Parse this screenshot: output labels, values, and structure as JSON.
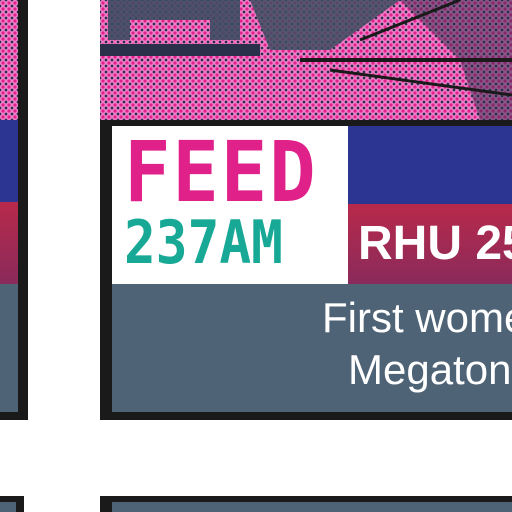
{
  "logo": {
    "line1": "FEED",
    "line2": "237AM"
  },
  "banner": {
    "code": "RHU 25"
  },
  "description": {
    "line1": "First wome",
    "line2": "Megaton"
  },
  "colors": {
    "magenta": "#e0218a",
    "teal": "#17a896",
    "navy": "#2d3592",
    "crimson": "#b8294a",
    "slate": "#4f6377",
    "border": "#1a1a1a"
  }
}
